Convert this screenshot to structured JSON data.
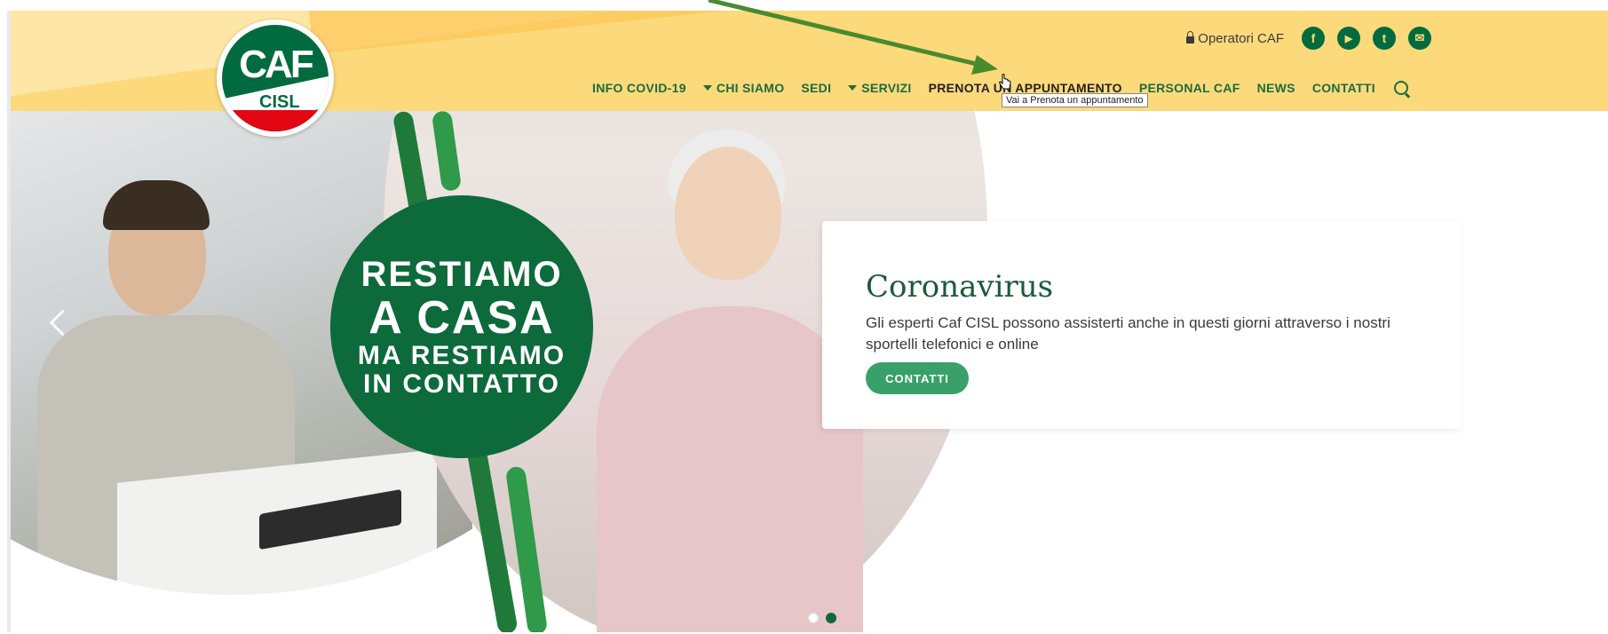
{
  "header": {
    "logo": {
      "caf": "CAF",
      "cisl": "CISL"
    },
    "operatori_label": "Operatori CAF",
    "social": [
      {
        "icon": "facebook-icon",
        "glyph": "f"
      },
      {
        "icon": "youtube-icon",
        "glyph": "▶"
      },
      {
        "icon": "twitter-icon",
        "glyph": "t"
      },
      {
        "icon": "mail-icon",
        "glyph": "✉"
      }
    ],
    "nav": [
      {
        "label": "INFO COVID-19",
        "dropdown": false
      },
      {
        "label": "CHI SIAMO",
        "dropdown": true
      },
      {
        "label": "SEDI",
        "dropdown": false
      },
      {
        "label": "SERVIZI",
        "dropdown": true
      },
      {
        "label": "PRENOTA UN APPUNTAMENTO",
        "dropdown": false,
        "hovered": true
      },
      {
        "label": "PERSONAL CAF",
        "dropdown": false
      },
      {
        "label": "NEWS",
        "dropdown": false
      },
      {
        "label": "CONTATTI",
        "dropdown": false
      }
    ],
    "tooltip": "Vai a Prenota un appuntamento"
  },
  "hero": {
    "badge": {
      "line1": "RESTIAMO",
      "line2": "A CASA",
      "line3": "MA RESTIAMO",
      "line4": "IN CONTATTO"
    },
    "card": {
      "title": "Coronavirus",
      "text": "Gli esperti Caf CISL possono assisterti anche in questi giorni attraverso i nostri sportelli telefonici e online",
      "button": "CONTATTI"
    },
    "slides": {
      "count": 2,
      "active": 2
    }
  },
  "colors": {
    "header_bg": "#fcd97a",
    "brand_green": "#0c6a3b",
    "button_green": "#3aa06a",
    "annotation_arrow": "#4a8a2e",
    "logo_red": "#e30613"
  }
}
